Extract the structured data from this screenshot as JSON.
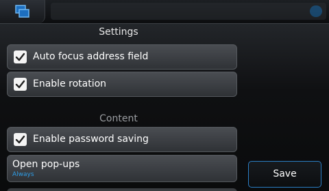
{
  "dialog": {
    "title": "Settings"
  },
  "items": [
    {
      "label": "Auto focus address field",
      "checked": true
    },
    {
      "label": "Enable rotation",
      "checked": true
    }
  ],
  "section": {
    "content_label": "Content"
  },
  "content_items": [
    {
      "label": "Enable password saving",
      "checked": true
    }
  ],
  "popups": {
    "label": "Open pop-ups",
    "value": "Always"
  },
  "buttons": {
    "save_label": "Save"
  },
  "icons": {
    "switcher": "task-switcher-icon",
    "check": "checkmark-icon"
  },
  "colors": {
    "accent": "#2e9ee8",
    "save_border": "#2b7fc6"
  }
}
